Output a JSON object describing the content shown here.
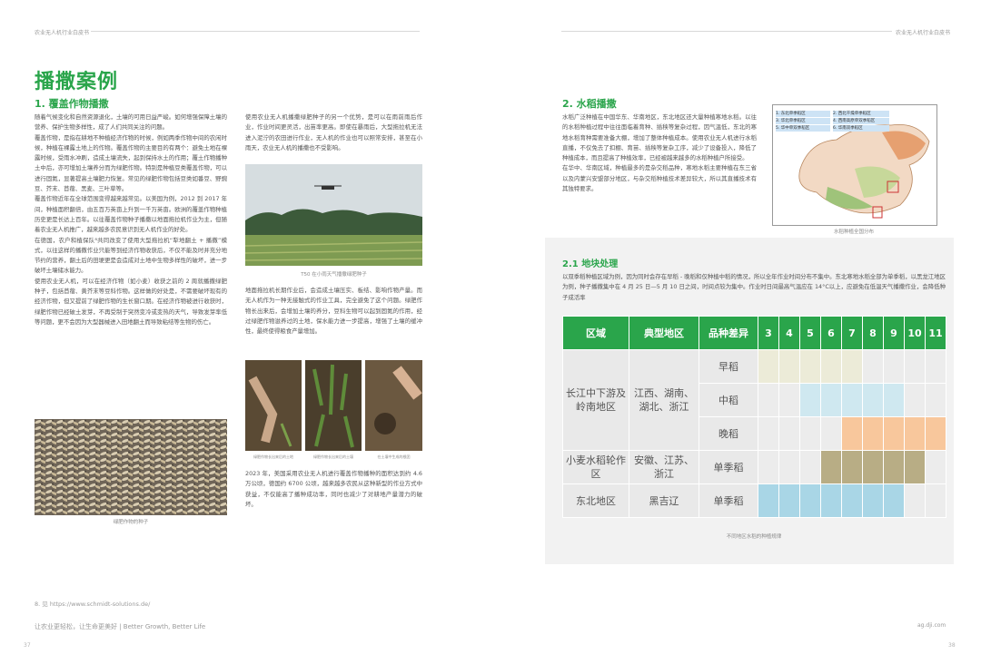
{
  "header": {
    "left": "农业无人机行业白皮书",
    "right": "农业无人机行业白皮书"
  },
  "left_page": {
    "title": "播撒案例",
    "section1_heading": "1. 覆盖作物播撒",
    "col1_paragraphs": [
      "随着气候变化和自然资源退化，土壤的可用日益严峻。如何增强保障土壤的营养、保护生物多样性，成了人们共同关注的问题。",
      "覆盖作物，是指在耕地不种植经济作物的时候，例如两季作物中间的农闲时候，种植在裸露土地上的作物。覆盖作物的主要目的有两个：避免土地在裸露时候，受雨水冲刷，造成土壤流失，起到保持水土的作用；覆土作物播种土中后，亦可增加土壤养分而为绿肥作物。特别是种植豆类覆盖作物，可以进行固氮，显著提高土壤肥力恢复。常见的绿肥作物包括豆类如番豆、野豌豆、芥末、苜蓿、黑麦、三叶草等。",
      "覆盖作物近年在全球范围变得越来越常见。以美国为例，2012 到 2017 年间，种植面积翻倍，由五百万英亩上升到一千万英亩。欧洲的覆盖作物种植历史更是长达上百年。以往覆盖作物种子播撒以地面拖拉机作业为主，但随着农业无人机推广，越来越多农民意识到无人机作业的好处。",
      "在德国，农户和植保队⁸共同改变了使用大型拖拉机“犁地翻土 + 播撒”模式，以往这样的播撒作业只能等到经济作物收获后，不仅不能及时并充分地节约的营养，翻土后的田埂更是会造成对土地中生物多样性的破坏，进一步破坏土壤储水能力。",
      "使用农业无人机，可以在经济作物（如小麦）收获之前的 2 周就播撒绿肥种子，包括苜蓿、黄芥末等豆科作物。这样做的好处是，不需要破坏现有的经济作物，但又提前了绿肥作物的生长窗口期。在经济作物被进行收获时，绿肥作物已经破土发芽，不再受制于突然变冷或变热的天气，导致发芽率低等问题，更不会因为大型器械进入田地翻土而导致粘结等生物的伤亡。"
    ],
    "col2_paragraph1": "使用农业无人机播撒绿肥种子的另一个优势，是可以在雨前雨后作业，作业时间更灵活，出苗率更高。即使在暴雨后，大型拖拉机无法进入泥泞的农田进行作业，无人机的作业也可以照常安排，甚至在小雨天，农业无人机的播撒也不受影响。",
    "col2_paragraph2": "地面拖拉机长期作业后，会造成土壤压实、板结、影响作物产量。而无人机作为一种无接触式的作业工具，完全避免了这个问题。绿肥作物长出来后，会增加土壤的养分，豆科生物可以起到固氮的作用，经过绿肥作物滋养过的土地，保水能力进一步提高，增强了土壤的缓冲性，最终使得粮食产量增加。",
    "col2_paragraph3": "2023 年，美国采用农业无人机进行覆盖作物播种的面积达到约 4.6 万公顷，德国约 6700 公顷，越来越多农民从这种新型的作业方式中获益，不仅能高了播种成功率，同时也减少了对耕地产量潜力的破坏。",
    "seed_caption": "绿肥作物的种子",
    "drone_caption": "T50 在小雨天气播撒绿肥种子",
    "small_captions": [
      "绿肥作物长出来后的土地",
      "绿肥作物长出来后的土壤",
      "在土壤中生成的根团"
    ],
    "footnote": "8. 见 https://www.schmidt-solutions.de/",
    "slogan": "让农业更轻松，让生命更美好 | Better Growth, Better Life",
    "page_number": "37"
  },
  "right_page": {
    "section2_heading": "2. 水稻播撒",
    "section2_paragraphs": [
      "水稻广泛种植在中国华东、华南地区，东北地区还大量种植寒地水稻。以往的水稻种植过程中往往面临着育种、插秧等复杂过程，因气温低，东北的寒地水稻育种需要准备大棚，增加了整体种植成本。使用农业无人机进行水稻直播，不仅免去了扣棚、育苗、插秧等复杂工序，减少了设备投入，降低了种植成本，而且提高了种植效率，已经被越来越多的水稻种植户所接受。",
      "在华中、华南区域，种植最多的是杂交稻品种，寒地水稻主要种植在东三省以及内蒙兴安盟部分地区，与杂交稻种植技术差异较大，所以其直播技术有其独特要求。"
    ],
    "map_legend": [
      "1. 东北单季稻区",
      "2. 西北干燥单季稻区",
      "3. 华北单季稻区",
      "4. 西南高原单双季稻区",
      "5. 华中单双季稻区",
      "6. 华南双季稻区"
    ],
    "map_caption": "水稻种植全国分布",
    "section21_heading": "2.1 地块处理",
    "section21_paragraph": "以双季稻种植区域为例，因为同时会存在早稻 - 晚稻和仅种植中稻的情况，所以全年作业时间分布不集中。东北寒地水稻全部为单季稻，以黑龙江地区为例，种子播撒集中在 4 月 25 日—5 月 10 日之间，时间点较为集中。作业时日间最高气温应在 14°C以上，应避免在低温天气播撒作业，会降低种子成活率",
    "table_caption": "不同地区水稻的种植规律",
    "website": "ag.dji.com",
    "page_number": "38"
  },
  "table": {
    "headers": [
      "区域",
      "典型地区",
      "品种差异"
    ],
    "months": [
      "3",
      "4",
      "5",
      "6",
      "7",
      "8",
      "9",
      "10",
      "11"
    ],
    "groups": [
      {
        "region": "长江中下游及岭南地区",
        "area": "江西、湖南、湖北、浙江",
        "rows": [
          {
            "variety": "早稻",
            "fill": "beige",
            "start": 3,
            "end": 7
          },
          {
            "variety": "中稻",
            "fill": "blue",
            "start": 5,
            "end": 9
          },
          {
            "variety": "晚稻",
            "fill": "orange",
            "start": 7,
            "end": 11
          }
        ]
      },
      {
        "region": "小麦水稻轮作区",
        "area": "安徽、江苏、浙江",
        "rows": [
          {
            "variety": "单季稻",
            "fill": "olive",
            "start": 6,
            "end": 10
          }
        ]
      },
      {
        "region": "东北地区",
        "area": "黑吉辽",
        "rows": [
          {
            "variety": "单季稻",
            "fill": "sky",
            "start": 3,
            "end": 9
          }
        ]
      }
    ],
    "colors": {
      "header": "#2aa54b",
      "beige": "#ecebd8",
      "blue": "#cfe8f0",
      "orange": "#f8c79c",
      "olive": "#b8ad85",
      "sky": "#a9d6e6",
      "empty": "#ececec"
    }
  }
}
